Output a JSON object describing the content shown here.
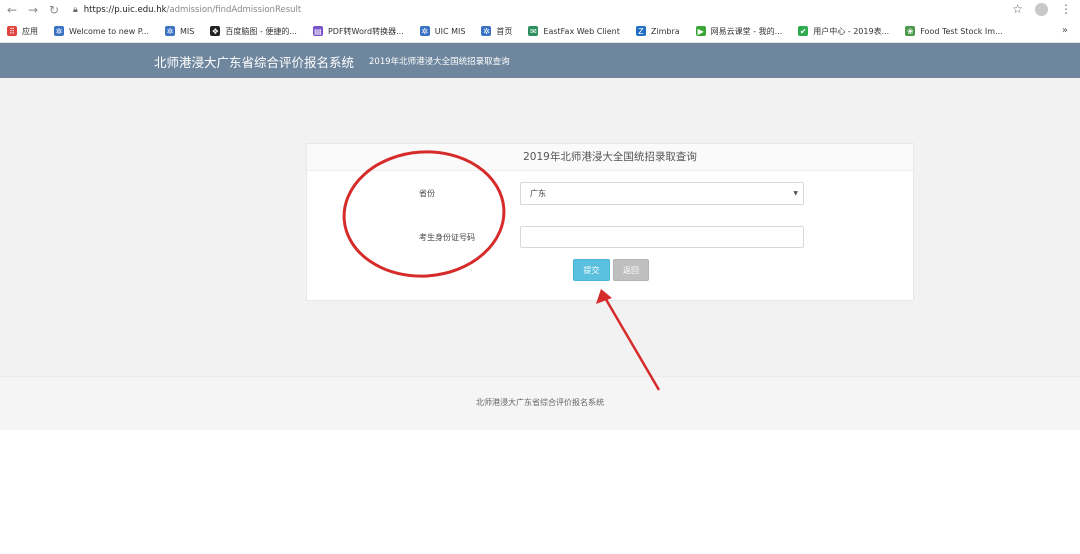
{
  "browser": {
    "url_host": "https://p.uic.edu.hk",
    "url_path": "/admission/findAdmissionResult",
    "bookmarks": [
      {
        "label": "应用",
        "icon": "apps-grid-icon",
        "color": "#e0433d"
      },
      {
        "label": "Welcome to new P...",
        "icon": "gear-icon",
        "color": "#3b73c4"
      },
      {
        "label": "MIS",
        "icon": "gear-icon",
        "color": "#3b73c4"
      },
      {
        "label": "百度脑图 - 便捷的...",
        "icon": "baidu-paw-icon",
        "color": "#222222"
      },
      {
        "label": "PDF转Word转换器...",
        "icon": "pdf-icon",
        "color": "#7b53c9"
      },
      {
        "label": "UIC MIS",
        "icon": "gear-icon",
        "color": "#3b73c4"
      },
      {
        "label": "首页",
        "icon": "gear-icon",
        "color": "#3b73c4"
      },
      {
        "label": "EastFax Web Client",
        "icon": "fax-icon",
        "color": "#2e8f5e"
      },
      {
        "label": "Zimbra",
        "icon": "zimbra-icon",
        "color": "#1f6fc2"
      },
      {
        "label": "网易云课堂 - 我的...",
        "icon": "netease-icon",
        "color": "#3aa63a"
      },
      {
        "label": "用户中心 - 2019表...",
        "icon": "shield-icon",
        "color": "#2eaa4f"
      },
      {
        "label": "Food Test Stock Im...",
        "icon": "food-icon",
        "color": "#4a9a4a"
      }
    ],
    "bookmarks_more": "»"
  },
  "header": {
    "site_title": "北师港浸大广东省综合评价报名系统",
    "nav_link": "2019年北师港浸大全国统招录取查询"
  },
  "form": {
    "title": "2019年北师港浸大全国统招录取查询",
    "province_label": "省份",
    "province_value": "广东",
    "id_label": "考生身份证号码",
    "id_value": "",
    "submit_label": "提交",
    "back_label": "返回"
  },
  "footer": {
    "text": "北师港浸大广东省综合评价报名系统"
  },
  "colors": {
    "header_bg": "#6f879e",
    "submit_bg": "#5bc0de",
    "back_bg": "#bfbfbf",
    "annotation": "#d62b2b"
  }
}
